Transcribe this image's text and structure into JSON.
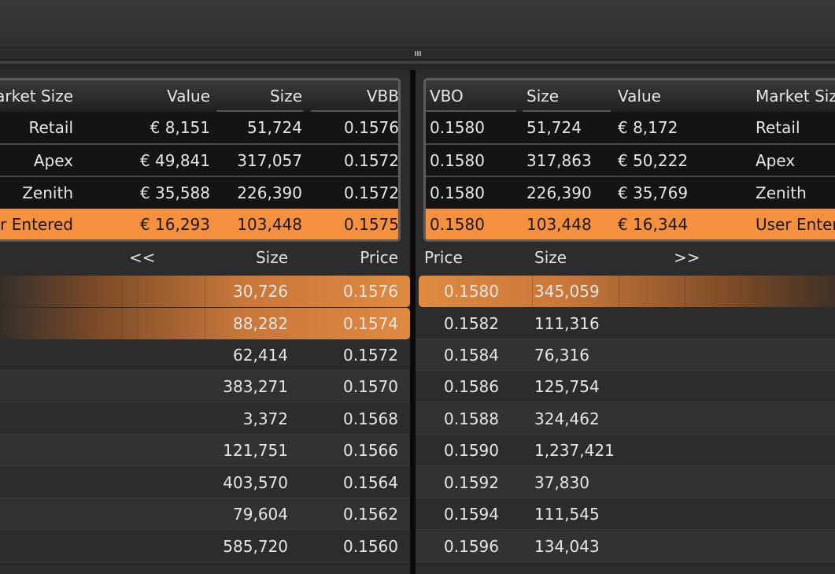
{
  "colors": {
    "accent": "#f5913e",
    "background": "#262626"
  },
  "bid_vb": {
    "headers": {
      "market_size": "arket Size",
      "value": "Value",
      "size": "Size",
      "vbb": "VBB"
    },
    "rows": [
      {
        "market_size": "Retail",
        "value": "€ 8,151",
        "size": "51,724",
        "vbb": "0.1576"
      },
      {
        "market_size": "Apex",
        "value": "€ 49,841",
        "size": "317,057",
        "vbb": "0.1572"
      },
      {
        "market_size": "Zenith",
        "value": "€ 35,588",
        "size": "226,390",
        "vbb": "0.1572"
      },
      {
        "market_size": "r Entered",
        "value": "€ 16,293",
        "size": "103,448",
        "vbb": "0.1575"
      }
    ]
  },
  "ask_vb": {
    "headers": {
      "vbo": "VBO",
      "size": "Size",
      "value": "Value",
      "market_size": "Market Siz"
    },
    "rows": [
      {
        "vbo": "0.1580",
        "size": "51,724",
        "value": "€ 8,172",
        "market_size": "Retail"
      },
      {
        "vbo": "0.1580",
        "size": "317,863",
        "value": "€ 50,222",
        "market_size": "Apex"
      },
      {
        "vbo": "0.1580",
        "size": "226,390",
        "value": "€ 35,769",
        "market_size": "Zenith"
      },
      {
        "vbo": "0.1580",
        "size": "103,448",
        "value": "€ 16,344",
        "market_size": "User Enter"
      }
    ]
  },
  "bid_depth": {
    "headers": {
      "nav": "<<",
      "size": "Size",
      "price": "Price"
    },
    "rows": [
      {
        "size": "30,726",
        "price": "0.1576"
      },
      {
        "size": "88,282",
        "price": "0.1574"
      },
      {
        "size": "62,414",
        "price": "0.1572"
      },
      {
        "size": "383,271",
        "price": "0.1570"
      },
      {
        "size": "3,372",
        "price": "0.1568"
      },
      {
        "size": "121,751",
        "price": "0.1566"
      },
      {
        "size": "403,570",
        "price": "0.1564"
      },
      {
        "size": "79,604",
        "price": "0.1562"
      },
      {
        "size": "585,720",
        "price": "0.1560"
      }
    ]
  },
  "ask_depth": {
    "headers": {
      "price": "Price",
      "size": "Size",
      "nav": ">>"
    },
    "rows": [
      {
        "price": "0.1580",
        "size": "345,059"
      },
      {
        "price": "0.1582",
        "size": "111,316"
      },
      {
        "price": "0.1584",
        "size": "76,316"
      },
      {
        "price": "0.1586",
        "size": "125,754"
      },
      {
        "price": "0.1588",
        "size": "324,462"
      },
      {
        "price": "0.1590",
        "size": "1,237,421"
      },
      {
        "price": "0.1592",
        "size": "37,830"
      },
      {
        "price": "0.1594",
        "size": "111,545"
      },
      {
        "price": "0.1596",
        "size": "134,043"
      }
    ]
  }
}
